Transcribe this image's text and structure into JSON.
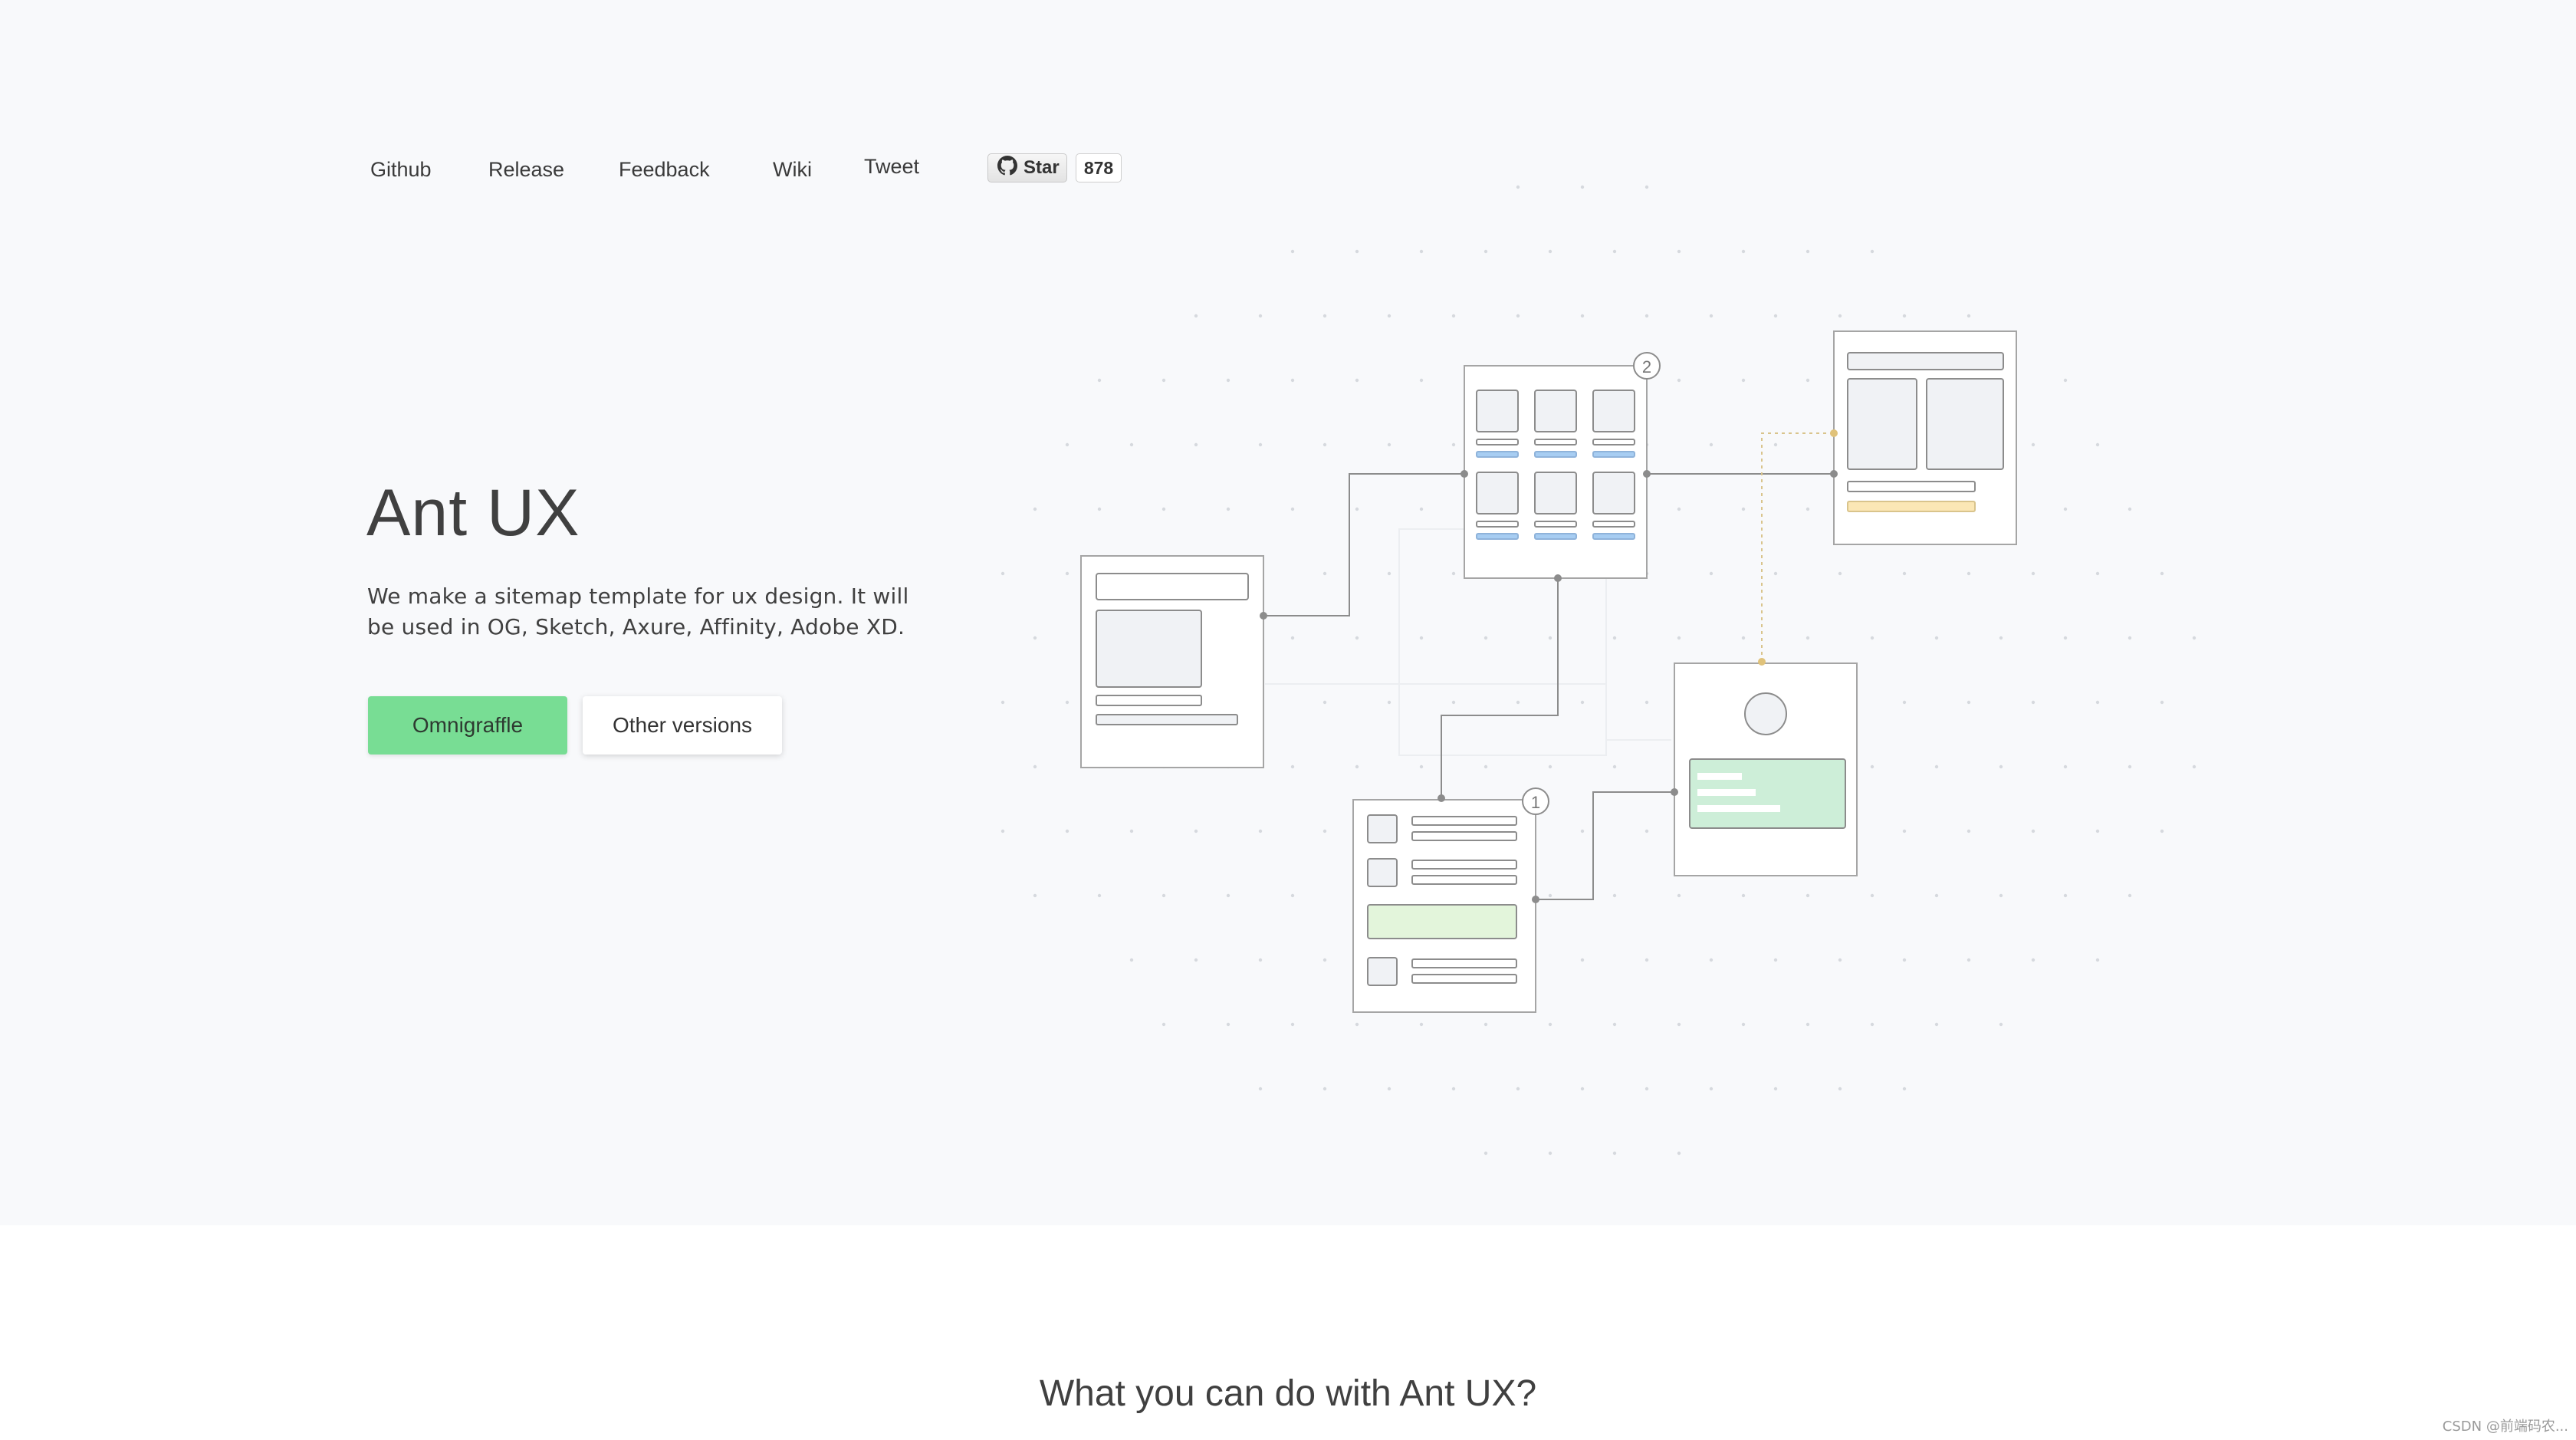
{
  "nav": {
    "links": [
      "Github",
      "Release",
      "Feedback",
      "Wiki",
      "Tweet"
    ],
    "star_label": "Star",
    "star_count": "878"
  },
  "hero": {
    "title": "Ant UX",
    "description": "We make a sitemap template for ux design. It will be used in OG, Sketch, Axure, Affinity, Adobe XD.",
    "primary_button": "Omnigraffle",
    "secondary_button": "Other versions"
  },
  "sitemap": {
    "badges": [
      "1",
      "2"
    ],
    "colors": {
      "line": "#8a8a8a",
      "page_border": "#a5a5a5",
      "accent_green": "#cdeed8",
      "accent_blue": "#a7cdf2",
      "accent_yellow": "#fbe7b5"
    }
  },
  "features": {
    "heading": "What you can do with Ant UX?"
  },
  "watermark": "CSDN @前端码农..."
}
